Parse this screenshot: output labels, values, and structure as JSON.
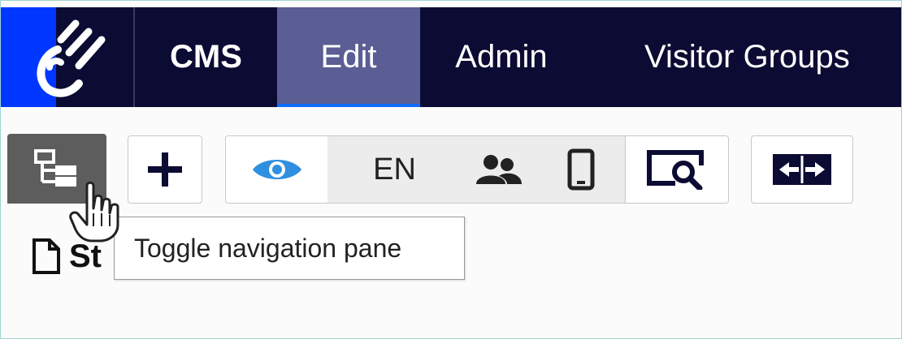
{
  "nav": {
    "items": [
      {
        "label": "CMS"
      },
      {
        "label": "Edit",
        "active": true
      },
      {
        "label": "Admin"
      },
      {
        "label": "Visitor Groups"
      }
    ],
    "logo_icon": "optimizely-logo"
  },
  "toolbar": {
    "tree_icon": "tree-icon",
    "add_icon": "plus-icon",
    "view_icon": "eye-icon",
    "language": "EN",
    "users_icon": "users-icon",
    "device_icon": "tablet-icon",
    "preview_icon": "preview-search-icon",
    "compare_icon": "compare-icon"
  },
  "page": {
    "title_fragment": "St"
  },
  "tooltip": {
    "text": "Toggle navigation pane"
  },
  "colors": {
    "nav_bg": "#0b0b33",
    "logo_blue": "#0037ff",
    "active_tab": "#5b5d95",
    "active_underline": "#0f6cff",
    "eye_blue": "#2f8fe0"
  }
}
